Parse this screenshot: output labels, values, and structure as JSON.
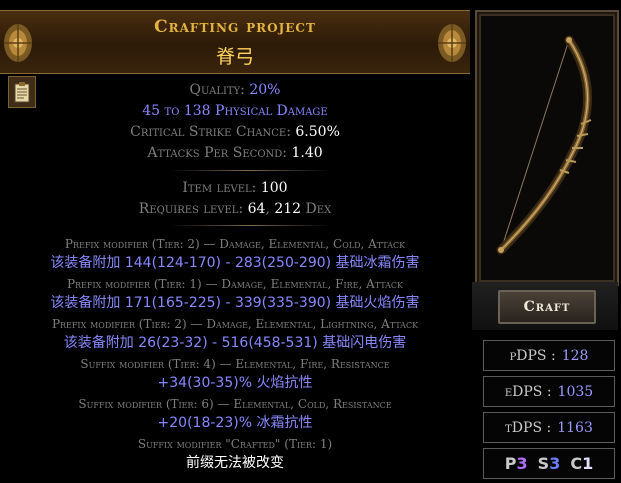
{
  "header": {
    "title": "Crafting project",
    "subtitle": "脊弓"
  },
  "properties": [
    {
      "label": "Quality:",
      "value": "20%"
    },
    {
      "text": "45 to 138 Physical Damage"
    },
    {
      "label": "Critical Strike Chance:",
      "value": "6.50%"
    },
    {
      "label": "Attacks Per Second:",
      "value": "1.40"
    }
  ],
  "requirements": {
    "item_level_label": "Item level:",
    "item_level": "100",
    "requires_label": "Requires level:",
    "requires_level": "64",
    "sep": ",",
    "dex": "212",
    "dex_label": "Dex"
  },
  "mods": [
    {
      "header": "Prefix modifier (Tier: 2) — Damage, Elemental, Cold, Attack",
      "text": "该装备附加 144(124-170) - 283(250-290) 基础冰霜伤害"
    },
    {
      "header": "Prefix modifier (Tier: 1) — Damage, Elemental, Fire, Attack",
      "text": "该装备附加 171(165-225) - 339(335-390) 基础火焰伤害"
    },
    {
      "header": "Prefix modifier (Tier: 2) — Damage, Elemental, Lightning, Attack",
      "text": "该装备附加 26(23-32) - 516(458-531) 基础闪电伤害"
    },
    {
      "header": "Suffix modifier (Tier: 4) — Elemental, Fire, Resistance",
      "text": "+34(30-35)% 火焰抗性"
    },
    {
      "header": "Suffix modifier (Tier: 6) — Elemental, Cold, Resistance",
      "text": "+20(18-23)% 冰霜抗性"
    },
    {
      "header": "Suffix modifier \"Crafted\" (Tier: 1)",
      "text": "前缀无法被改变"
    }
  ],
  "craft_label": "Craft",
  "stats": [
    {
      "label": "pDPS :",
      "value": "128"
    },
    {
      "label": "eDPS :",
      "value": "1035"
    },
    {
      "label": "tDPS :",
      "value": "1163"
    }
  ],
  "affixes": {
    "p_label": "P",
    "p_value": "3",
    "s_label": "S",
    "s_value": "3",
    "c_label": "C",
    "c_value": "1"
  },
  "colors": {
    "title_gold": "#e3b43f",
    "magic_blue": "#8888ff",
    "label_gray": "#7f7f7f"
  },
  "icons": [
    "ornament-left-icon",
    "ornament-right-icon",
    "clipboard-icon",
    "bow-item-icon"
  ]
}
